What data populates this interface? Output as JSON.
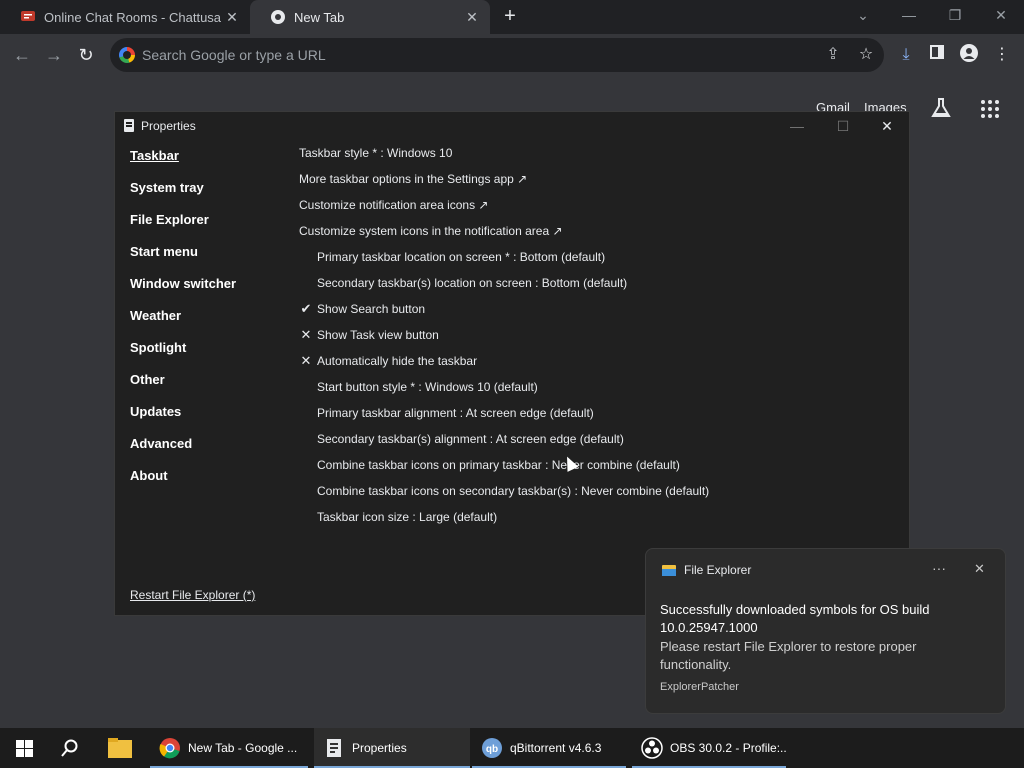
{
  "browser": {
    "tabs": [
      {
        "title": "Online Chat Rooms - Chattusa",
        "active": false
      },
      {
        "title": "New Tab",
        "active": true
      }
    ],
    "omnibox": {
      "placeholder": "Search Google or type a URL"
    },
    "page_links": {
      "gmail": "Gmail",
      "images": "Images"
    }
  },
  "properties": {
    "title": "Properties",
    "sidebar": [
      {
        "label": "Taskbar",
        "active": true
      },
      {
        "label": "System tray"
      },
      {
        "label": "File Explorer"
      },
      {
        "label": "Start menu"
      },
      {
        "label": "Window switcher"
      },
      {
        "label": "Weather"
      },
      {
        "label": "Spotlight"
      },
      {
        "label": "Other"
      },
      {
        "label": "Updates"
      },
      {
        "label": "Advanced"
      },
      {
        "label": "About"
      }
    ],
    "options": [
      {
        "text": "Taskbar style * : Windows 10",
        "indent": 0,
        "mark": ""
      },
      {
        "text": "More taskbar options in the Settings app ↗",
        "indent": 0,
        "mark": ""
      },
      {
        "text": "Customize notification area icons ↗",
        "indent": 0,
        "mark": ""
      },
      {
        "text": "Customize system icons in the notification area ↗",
        "indent": 0,
        "mark": ""
      },
      {
        "text": "Primary taskbar location on screen * : Bottom (default)",
        "indent": 1,
        "mark": ""
      },
      {
        "text": "Secondary taskbar(s) location on screen : Bottom (default)",
        "indent": 1,
        "mark": ""
      },
      {
        "text": "Show Search button",
        "indent": 1,
        "mark": "✔"
      },
      {
        "text": "Show Task view button",
        "indent": 1,
        "mark": "✕"
      },
      {
        "text": "Automatically hide the taskbar",
        "indent": 1,
        "mark": "✕"
      },
      {
        "text": "Start button style * : Windows 10 (default)",
        "indent": 1,
        "mark": ""
      },
      {
        "text": "Primary taskbar alignment : At screen edge (default)",
        "indent": 1,
        "mark": ""
      },
      {
        "text": "Secondary taskbar(s) alignment : At screen edge (default)",
        "indent": 1,
        "mark": ""
      },
      {
        "text": "Combine taskbar icons on primary taskbar : Never combine (default)",
        "indent": 1,
        "mark": ""
      },
      {
        "text": "Combine taskbar icons on secondary taskbar(s) : Never combine (default)",
        "indent": 1,
        "mark": ""
      },
      {
        "text": "Taskbar icon size : Large (default)",
        "indent": 1,
        "mark": ""
      }
    ],
    "restart_link": "Restart File Explorer (*)"
  },
  "toast": {
    "app": "File Explorer",
    "message": "Successfully downloaded symbols for OS build 10.0.25947.1000",
    "detail": "Please restart File Explorer to restore proper functionality.",
    "source": "ExplorerPatcher",
    "more": "···",
    "close": "✕"
  },
  "taskbar": {
    "items": [
      {
        "label": "New Tab - Google ..."
      },
      {
        "label": "Properties"
      },
      {
        "label": "qBittorrent v4.6.3"
      },
      {
        "label": "OBS 30.0.2 - Profile:..."
      }
    ]
  },
  "colors": {
    "accent": "#7aa7d8",
    "window_bg": "#202020",
    "browser_bg": "#35363a"
  }
}
